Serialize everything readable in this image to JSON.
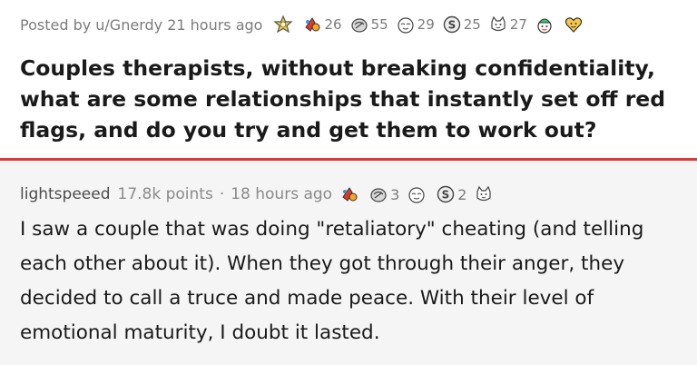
{
  "post": {
    "posted_by": "Posted by u/Gnerdy 21 hours ago",
    "awards": [
      {
        "icon": "silver-award-icon",
        "count": ""
      },
      {
        "icon": "helpful-award-icon",
        "count": "26"
      },
      {
        "icon": "wholesome-award-icon",
        "count": "55"
      },
      {
        "icon": "hugz-award-icon",
        "count": "29"
      },
      {
        "icon": "coin-award-icon",
        "count": "25"
      },
      {
        "icon": "bravo-award-icon",
        "count": "27"
      },
      {
        "icon": "party-award-icon",
        "count": ""
      },
      {
        "icon": "heart-award-icon",
        "count": ""
      }
    ],
    "title": "Couples therapists, without breaking confidentiality, what are some relationships that instantly set off red flags, and do you try and get them to work out?"
  },
  "comment": {
    "username": "lightspeeed",
    "points": "17.8k points",
    "separator": "·",
    "time": "18 hours ago",
    "awards": [
      {
        "icon": "helpful-award-icon",
        "count": ""
      },
      {
        "icon": "wholesome-award-icon",
        "count": "3"
      },
      {
        "icon": "hugz-award-icon",
        "count": ""
      },
      {
        "icon": "coin-award-icon",
        "count": "2"
      },
      {
        "icon": "bravo-award-icon",
        "count": ""
      }
    ],
    "body": "I saw a couple that was doing \"retaliatory\" cheating (and telling each other about it). When they got through their anger, they decided to call a truce and made peace. With their level of emotional maturity, I doubt it lasted."
  },
  "colors": {
    "divider": "#d93a3a",
    "comment_bg": "#f5f5f5",
    "text": "#1a1a1b",
    "meta_text": "#7c7c7c"
  }
}
